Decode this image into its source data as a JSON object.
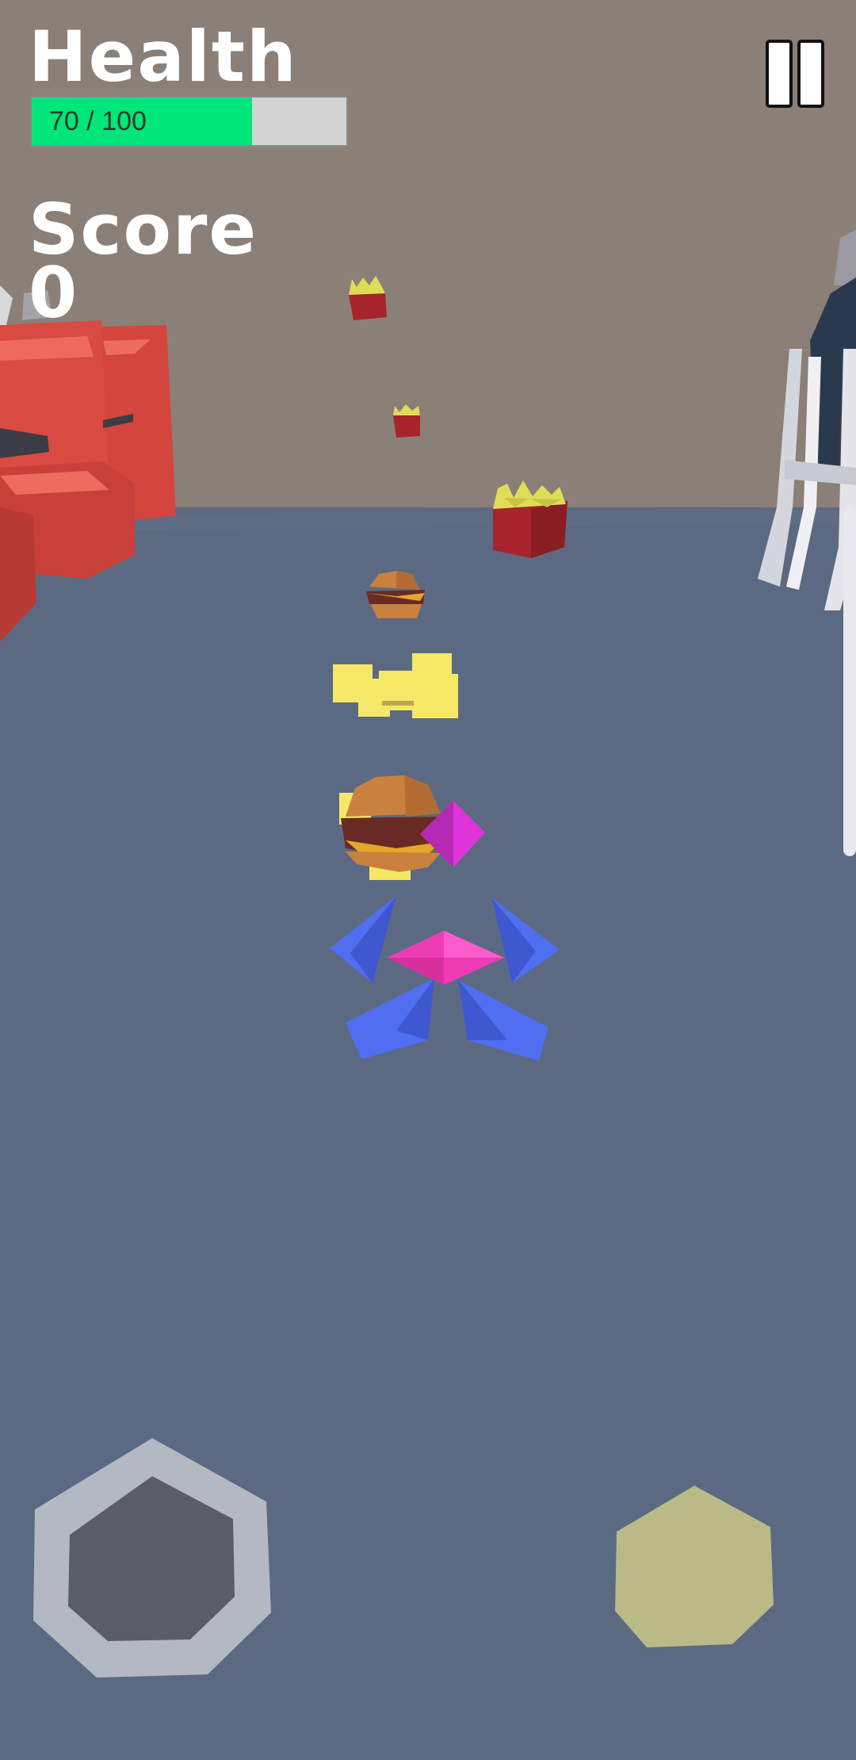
{
  "hud": {
    "health_label": "Health",
    "health_value": 70,
    "health_max": 100,
    "health_text": "70 / 100",
    "score_label": "Score",
    "score_value": "0"
  },
  "icons": {
    "pause": "pause-icon"
  },
  "colors": {
    "health_fill": "#00e67a",
    "health_track": "#d3d3d3",
    "floor": "#5b6a82",
    "wall": "#8a8077",
    "joystick_ring": "#b4b8c2",
    "joystick_knob": "#5a5c66",
    "action_button": "#b9ba86",
    "player_wings": "#4f6ef0",
    "player_core": "#f03cb4"
  }
}
